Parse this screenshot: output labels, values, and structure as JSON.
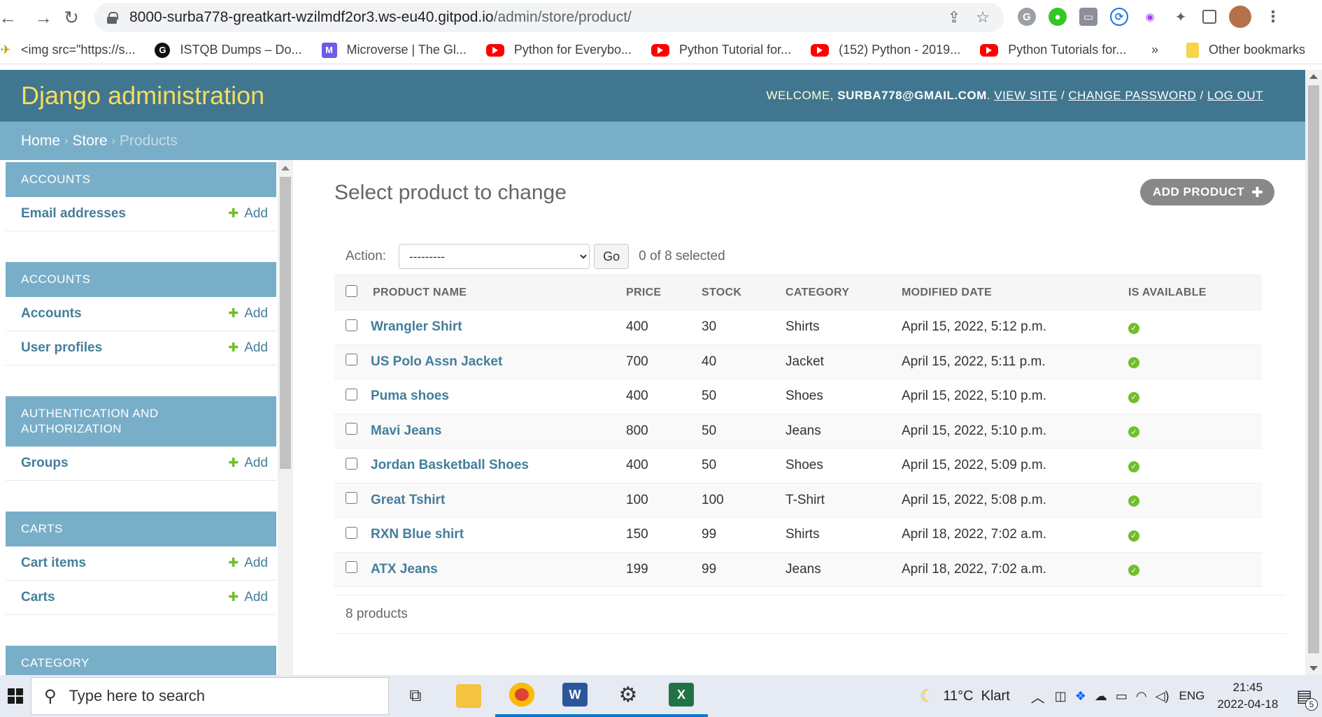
{
  "browser": {
    "url_host": "8000-surba778-greatkart-wzilmdf2or3.ws-eu40.gitpod.io",
    "url_path": "/admin/store/product/",
    "bookmarks": [
      {
        "label": "<img src=\"https://s...",
        "icon": "image-bookmark-icon"
      },
      {
        "label": "ISTQB Dumps – Do...",
        "icon": "istqb-g-icon"
      },
      {
        "label": "Microverse | The Gl...",
        "icon": "microverse-icon"
      },
      {
        "label": "Python for Everybo...",
        "icon": "youtube-icon"
      },
      {
        "label": "Python Tutorial for...",
        "icon": "youtube-icon"
      },
      {
        "label": "(152) Python - 2019...",
        "icon": "youtube-icon"
      },
      {
        "label": "Python Tutorials for...",
        "icon": "youtube-icon"
      }
    ],
    "more_bookmarks": "»",
    "other_bookmarks": "Other bookmarks"
  },
  "header": {
    "branding": "Django administration",
    "welcome": "WELCOME,",
    "user": "SURBA778@GMAIL.COM",
    "view_site": "VIEW SITE",
    "change_password": "CHANGE PASSWORD",
    "log_out": "LOG OUT",
    "sep": "/"
  },
  "breadcrumbs": {
    "home": "Home",
    "store": "Store",
    "current": "Products",
    "sep": "›"
  },
  "sidebar": {
    "add_label": "Add",
    "modules": [
      {
        "caption": "ACCOUNTS",
        "rows": [
          "Email addresses"
        ]
      },
      {
        "caption": "ACCOUNTS",
        "rows": [
          "Accounts",
          "User profiles"
        ]
      },
      {
        "caption": "AUTHENTICATION AND AUTHORIZATION",
        "rows": [
          "Groups"
        ]
      },
      {
        "caption": "CARTS",
        "rows": [
          "Cart items",
          "Carts"
        ]
      },
      {
        "caption": "CATEGORY",
        "rows": []
      }
    ]
  },
  "content": {
    "title": "Select product to change",
    "add_button": "ADD PRODUCT",
    "action_label": "Action:",
    "action_selected": "---------",
    "go": "Go",
    "selected_count": "0 of 8 selected",
    "columns": [
      "PRODUCT NAME",
      "PRICE",
      "STOCK",
      "CATEGORY",
      "MODIFIED DATE",
      "IS AVAILABLE"
    ],
    "rows": [
      {
        "name": "Wrangler Shirt",
        "price": "400",
        "stock": "30",
        "category": "Shirts",
        "modified": "April 15, 2022, 5:12 p.m."
      },
      {
        "name": "US Polo Assn Jacket",
        "price": "700",
        "stock": "40",
        "category": "Jacket",
        "modified": "April 15, 2022, 5:11 p.m."
      },
      {
        "name": "Puma shoes",
        "price": "400",
        "stock": "50",
        "category": "Shoes",
        "modified": "April 15, 2022, 5:10 p.m."
      },
      {
        "name": "Mavi Jeans",
        "price": "800",
        "stock": "50",
        "category": "Jeans",
        "modified": "April 15, 2022, 5:10 p.m."
      },
      {
        "name": "Jordan Basketball Shoes",
        "price": "400",
        "stock": "50",
        "category": "Shoes",
        "modified": "April 15, 2022, 5:09 p.m."
      },
      {
        "name": "Great Tshirt",
        "price": "100",
        "stock": "100",
        "category": "T-Shirt",
        "modified": "April 15, 2022, 5:08 p.m."
      },
      {
        "name": "RXN Blue shirt",
        "price": "150",
        "stock": "99",
        "category": "Shirts",
        "modified": "April 18, 2022, 7:02 a.m."
      },
      {
        "name": "ATX Jeans",
        "price": "199",
        "stock": "99",
        "category": "Jeans",
        "modified": "April 18, 2022, 7:02 a.m."
      }
    ],
    "paginator": "8 products"
  },
  "taskbar": {
    "search_placeholder": "Type here to search",
    "weather": "11°C  Klart",
    "language": "ENG",
    "time": "21:45",
    "date": "2022-04-18",
    "notifications": "5"
  },
  "colors": {
    "header": "#417690",
    "breadcrumbs": "#79aec8",
    "branding": "#f5dd5d",
    "link": "#447e9b",
    "available": "#70bf2b"
  }
}
